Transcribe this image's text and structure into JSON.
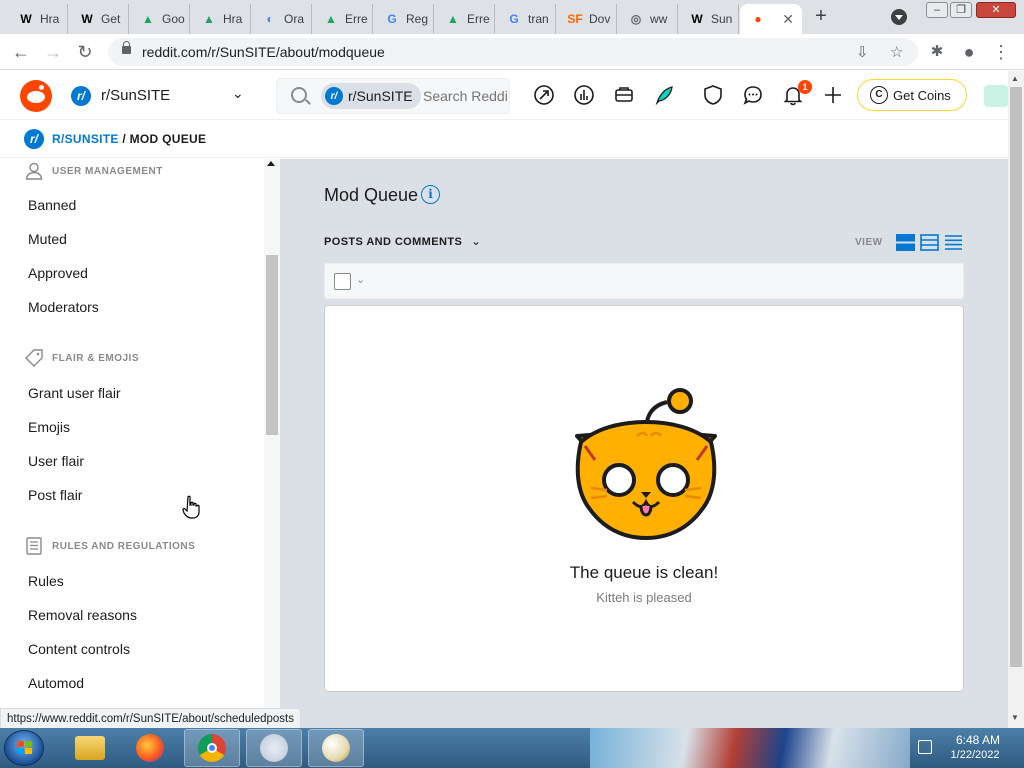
{
  "browser": {
    "tabs": [
      {
        "icon": "wikipedia-icon",
        "glyph": "W",
        "color": "#000000",
        "title": "Hra"
      },
      {
        "icon": "wikipedia-icon",
        "glyph": "W",
        "color": "#000000",
        "title": "Get"
      },
      {
        "icon": "google-drive-icon",
        "glyph": "▲",
        "color": "#1fa463",
        "title": "Goo"
      },
      {
        "icon": "google-drive-icon",
        "glyph": "▲",
        "color": "#1fa463",
        "title": "Hra"
      },
      {
        "icon": "oracle-icon",
        "glyph": "◐",
        "color": "#4285f4",
        "title": "Ora"
      },
      {
        "icon": "google-drive-icon",
        "glyph": "▲",
        "color": "#1fa463",
        "title": "Erre"
      },
      {
        "icon": "google-icon",
        "glyph": "G",
        "color": "#4285f4",
        "title": "Reg"
      },
      {
        "icon": "google-drive-icon",
        "glyph": "▲",
        "color": "#1fa463",
        "title": "Erre"
      },
      {
        "icon": "google-icon",
        "glyph": "G",
        "color": "#4285f4",
        "title": "tran"
      },
      {
        "icon": "sourceforge-icon",
        "glyph": "SF",
        "color": "#ff6600",
        "title": "Dov"
      },
      {
        "icon": "globe-icon",
        "glyph": "◎",
        "color": "#5f6368",
        "title": "ww"
      },
      {
        "icon": "wikipedia-icon",
        "glyph": "W",
        "color": "#000000",
        "title": "Sun"
      },
      {
        "icon": "reddit-icon",
        "glyph": "●",
        "color": "#ff4500",
        "title": ""
      }
    ],
    "url": "reddit.com/r/SunSITE/about/modqueue",
    "status_url": "https://www.reddit.com/r/SunSITE/about/scheduledposts"
  },
  "header": {
    "community": "r/SunSITE",
    "community_icon_letter": "r/",
    "search_chip": "r/SunSITE",
    "search_placeholder": "Search Reddit",
    "notification_count": "1",
    "get_coins": "Get Coins"
  },
  "breadcrumb": {
    "community": "R/SUNSITE",
    "separator": " / ",
    "page": "MOD QUEUE"
  },
  "sidebar": {
    "sections": [
      {
        "title": "USER MANAGEMENT",
        "icon": "user-icon",
        "items": [
          "Banned",
          "Muted",
          "Approved",
          "Moderators"
        ]
      },
      {
        "title": "FLAIR & EMOJIS",
        "icon": "tag-icon",
        "items": [
          "Grant user flair",
          "Emojis",
          "User flair",
          "Post flair"
        ]
      },
      {
        "title": "RULES AND REGULATIONS",
        "icon": "rules-icon",
        "items": [
          "Rules",
          "Removal reasons",
          "Content controls",
          "Automod"
        ]
      }
    ]
  },
  "main": {
    "title": "Mod Queue",
    "filter_label": "POSTS AND COMMENTS",
    "view_label": "VIEW",
    "empty_title": "The queue is clean!",
    "empty_subtitle": "Kitteh is pleased"
  },
  "taskbar": {
    "time": "6:48 AM",
    "date": "1/22/2022"
  },
  "colors": {
    "reddit_orange": "#ff4500",
    "reddit_blue": "#0079d3",
    "page_bg": "#dae0e6",
    "coins_border": "#ffd635"
  }
}
